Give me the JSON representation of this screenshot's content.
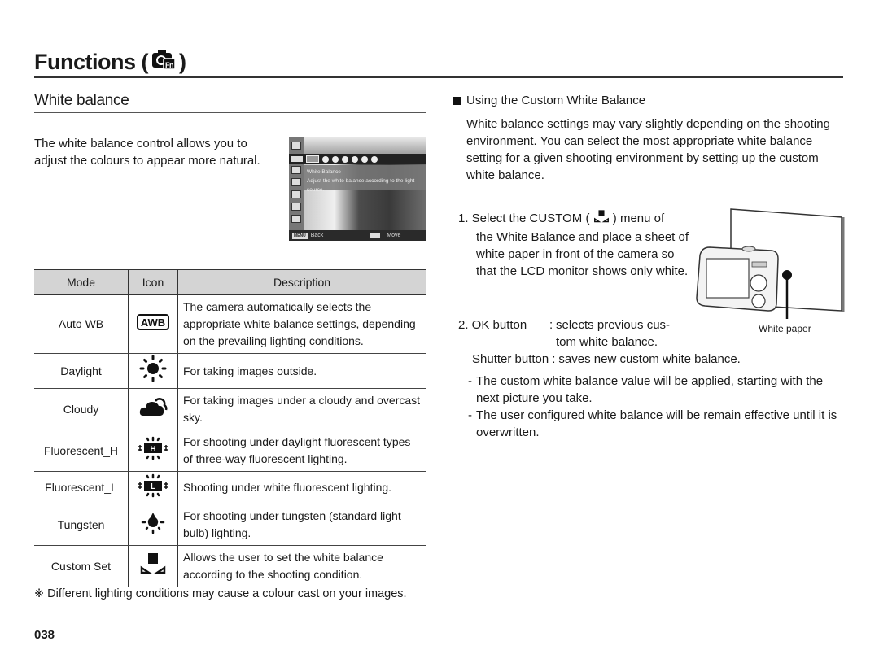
{
  "header": {
    "title": "Functions (",
    "title_close": ")",
    "title_icon": "camera-fn-icon"
  },
  "section": {
    "title": "White balance",
    "intro": "The white balance control allows you to adjust the colours to appear more natural."
  },
  "lcd_screen": {
    "menu_title": "White Balance",
    "menu_desc": "Adjust the white balance according to the light source.",
    "menu_key": "MENU",
    "back_label": "Back",
    "move_label": "Move"
  },
  "table": {
    "headers": [
      "Mode",
      "Icon",
      "Description"
    ],
    "rows": [
      {
        "mode": "Auto WB",
        "icon": "awb-icon",
        "description": "The camera automatically selects the appropriate white balance settings, depending on the prevailing lighting conditions."
      },
      {
        "mode": "Daylight",
        "icon": "daylight-icon",
        "description": "For taking images outside."
      },
      {
        "mode": "Cloudy",
        "icon": "cloudy-icon",
        "description": "For taking images under a cloudy and overcast sky."
      },
      {
        "mode": "Fluorescent_H",
        "icon": "fluorescent-h-icon",
        "description": "For shooting under daylight fluorescent types of three-way fluorescent lighting."
      },
      {
        "mode": "Fluorescent_L",
        "icon": "fluorescent-l-icon",
        "description": "Shooting under white fluorescent lighting."
      },
      {
        "mode": "Tungsten",
        "icon": "tungsten-icon",
        "description": "For shooting under tungsten (standard light bulb) lighting."
      },
      {
        "mode": "Custom Set",
        "icon": "custom-set-icon",
        "description": "Allows the user to set the white balance according to the shooting condition."
      }
    ]
  },
  "note": "※ Different lighting conditions may cause a colour cast on your images.",
  "page_number": "038",
  "custom_wb": {
    "heading": "Using the Custom White Balance",
    "paragraph": "White balance settings may vary slightly depending on the shooting environment. You can select the most appropriate white balance setting for a given shooting environment by setting up the custom white balance.",
    "step1_prefix": "1. Select the CUSTOM (",
    "step1_suffix": ") menu of",
    "step1_rest": "the White Balance and place a sheet of white paper in front of the camera so that the LCD monitor shows only white.",
    "step2_label": "2. OK button",
    "step2_sep": ":",
    "step2_text_1": "selects previous cus-",
    "step2_text_2": "tom white balance.",
    "shutter_label": "Shutter button",
    "shutter_text": "saves new custom white balance.",
    "bullets": [
      "The custom white balance value will be applied, starting with the next picture you take.",
      "The user configured white balance will be remain effective until it is overwritten."
    ],
    "illustration_label": "White paper"
  }
}
